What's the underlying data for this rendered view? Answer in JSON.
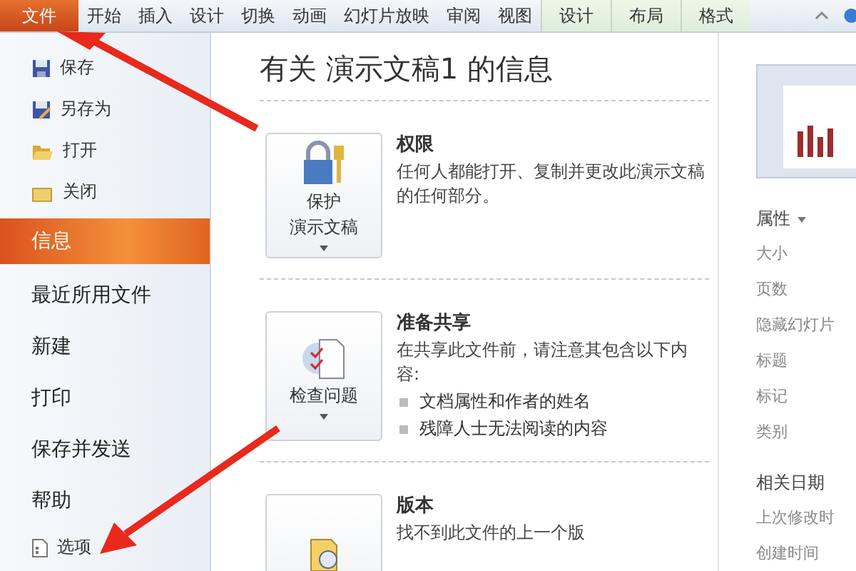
{
  "ribbon": {
    "tabs": [
      {
        "label": "文件",
        "selected": true,
        "kind": "file"
      },
      {
        "label": "开始",
        "selected": false,
        "kind": "main"
      },
      {
        "label": "插入",
        "selected": false,
        "kind": "main"
      },
      {
        "label": "设计",
        "selected": false,
        "kind": "main"
      },
      {
        "label": "切换",
        "selected": false,
        "kind": "main"
      },
      {
        "label": "动画",
        "selected": false,
        "kind": "main"
      },
      {
        "label": "幻灯片放映",
        "selected": false,
        "kind": "main"
      },
      {
        "label": "审阅",
        "selected": false,
        "kind": "main"
      },
      {
        "label": "视图",
        "selected": false,
        "kind": "main"
      },
      {
        "label": "设计",
        "selected": false,
        "kind": "context"
      },
      {
        "label": "布局",
        "selected": false,
        "kind": "context"
      },
      {
        "label": "格式",
        "selected": false,
        "kind": "context"
      }
    ]
  },
  "sidebar": {
    "items": [
      {
        "label": "保存",
        "kind": "command",
        "selected": false
      },
      {
        "label": "另存为",
        "kind": "command",
        "selected": false
      },
      {
        "label": "打开",
        "kind": "command",
        "selected": false
      },
      {
        "label": "关闭",
        "kind": "command",
        "selected": false
      },
      {
        "label": "信息",
        "kind": "page",
        "selected": true
      },
      {
        "label": "最近所用文件",
        "kind": "page",
        "selected": false
      },
      {
        "label": "新建",
        "kind": "page",
        "selected": false
      },
      {
        "label": "打印",
        "kind": "page",
        "selected": false
      },
      {
        "label": "保存并发送",
        "kind": "page",
        "selected": false
      },
      {
        "label": "帮助",
        "kind": "page",
        "selected": false
      },
      {
        "label": "选项",
        "kind": "command",
        "selected": false
      }
    ]
  },
  "info": {
    "title": "有关 演示文稿1 的信息",
    "sections": [
      {
        "button": [
          "保护",
          "演示文稿"
        ],
        "heading": "权限",
        "description": "任何人都能打开、复制并更改此演示文稿的任何部分。"
      },
      {
        "button": [
          "检查问题"
        ],
        "heading": "准备共享",
        "description": "在共享此文件前，请注意其包含以下内容:",
        "bullets": [
          "文档属性和作者的姓名",
          "残障人士无法阅读的内容"
        ]
      },
      {
        "heading": "版本",
        "description": "找不到此文件的上一个版"
      }
    ]
  },
  "properties": {
    "heading": "属性",
    "fields": [
      "大小",
      "页数",
      "隐藏幻灯片",
      "标题",
      "标记",
      "类别"
    ],
    "dates_heading": "相关日期",
    "dates": [
      "上次修改时",
      "创建时间"
    ]
  }
}
